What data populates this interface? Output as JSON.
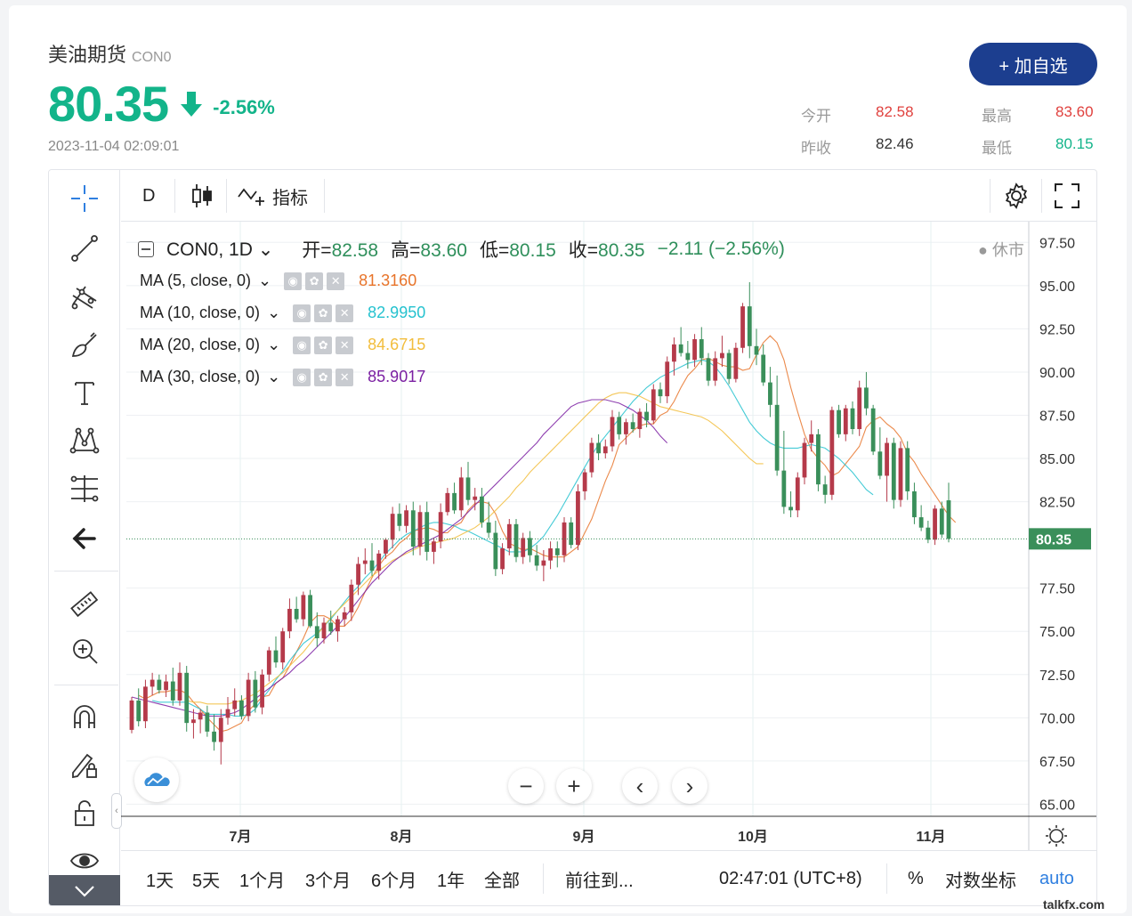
{
  "header": {
    "name": "美油期货",
    "code": "CON0",
    "price": "80.35",
    "change_pct": "-2.56%",
    "timestamp": "2023-11-04 02:09:01",
    "add_button": "+ 加自选"
  },
  "stats": {
    "open_label": "今开",
    "open_value": "82.58",
    "high_label": "最高",
    "high_value": "83.60",
    "prev_label": "昨收",
    "prev_value": "82.46",
    "low_label": "最低",
    "low_value": "80.15"
  },
  "toolbar": {
    "interval": "D",
    "indicators": "指标"
  },
  "legend": {
    "symbol": "CON0, 1D",
    "open_label": "开=",
    "open": "82.58",
    "high_label": "高=",
    "high": "83.60",
    "low_label": "低=",
    "low": "80.15",
    "close_label": "收=",
    "close": "80.35",
    "change": "−2.11 (−2.56%)",
    "market_status": "休市"
  },
  "ma_lines": [
    {
      "label": "MA (5, close, 0)",
      "value": "81.3160",
      "color": "#e8742a"
    },
    {
      "label": "MA (10, close, 0)",
      "value": "82.9950",
      "color": "#25c2cf"
    },
    {
      "label": "MA (20, close, 0)",
      "value": "84.6715",
      "color": "#f2bd3c"
    },
    {
      "label": "MA (30, close, 0)",
      "value": "85.9017",
      "color": "#7b1fa2"
    }
  ],
  "bottom_bar": {
    "ranges": [
      "1天",
      "5天",
      "1个月",
      "3个月",
      "6个月",
      "1年",
      "全部"
    ],
    "goto": "前往到...",
    "clock": "02:47:01 (UTC+8)",
    "percent": "%",
    "log": "对数坐标",
    "auto": "auto"
  },
  "watermark": "talkfx.com",
  "colors": {
    "up": "#b53a4a",
    "down": "#3a8f5a",
    "price_tag": "#3a8f5a"
  },
  "chart_data": {
    "type": "candlestick",
    "x_tick_labels": [
      "7月",
      "8月",
      "9月",
      "10月",
      "11月"
    ],
    "y_tick_labels": [
      "97.50",
      "95.00",
      "92.50",
      "90.00",
      "87.50",
      "85.00",
      "82.50",
      "80.35",
      "77.50",
      "75.00",
      "72.50",
      "70.00",
      "67.50",
      "65.00"
    ],
    "y_ticks": [
      97.5,
      95,
      92.5,
      90,
      87.5,
      85,
      82.5,
      77.5,
      75,
      72.5,
      70,
      67.5,
      65
    ],
    "ylim": [
      64.3,
      98.7
    ],
    "last_price": 80.35,
    "last_price_label": "80.35",
    "grid": true,
    "ohlc": [
      [
        69.3,
        71.2,
        69.1,
        71.0
      ],
      [
        71.0,
        71.7,
        69.5,
        69.8
      ],
      [
        69.8,
        72.2,
        69.4,
        71.8
      ],
      [
        71.8,
        72.6,
        71.3,
        72.2
      ],
      [
        72.2,
        72.5,
        71.4,
        71.6
      ],
      [
        71.6,
        72.5,
        71.2,
        72.1
      ],
      [
        72.1,
        72.9,
        70.7,
        71.0
      ],
      [
        71.0,
        73.2,
        70.7,
        72.6
      ],
      [
        72.6,
        73.0,
        69.2,
        69.7
      ],
      [
        69.7,
        70.5,
        68.8,
        69.9
      ],
      [
        69.9,
        70.5,
        69.1,
        70.3
      ],
      [
        70.3,
        70.7,
        68.9,
        69.2
      ],
      [
        69.2,
        70.2,
        68.1,
        68.6
      ],
      [
        68.6,
        70.5,
        67.3,
        70.0
      ],
      [
        70.0,
        71.2,
        69.6,
        70.5
      ],
      [
        70.5,
        71.7,
        70.1,
        71.0
      ],
      [
        71.0,
        71.3,
        69.9,
        70.1
      ],
      [
        70.1,
        72.6,
        69.8,
        72.2
      ],
      [
        72.2,
        72.7,
        70.3,
        70.6
      ],
      [
        70.6,
        72.8,
        70.2,
        72.5
      ],
      [
        72.5,
        74.1,
        72.1,
        73.9
      ],
      [
        73.9,
        74.7,
        72.9,
        73.2
      ],
      [
        73.2,
        75.2,
        72.8,
        75.0
      ],
      [
        75.0,
        76.9,
        74.6,
        76.3
      ],
      [
        76.3,
        77.0,
        75.5,
        75.7
      ],
      [
        75.7,
        77.3,
        75.3,
        77.1
      ],
      [
        77.1,
        77.4,
        75.2,
        75.3
      ],
      [
        75.3,
        76.1,
        74.1,
        74.6
      ],
      [
        74.6,
        75.8,
        74.3,
        75.5
      ],
      [
        75.5,
        76.2,
        74.8,
        75.0
      ],
      [
        75.0,
        75.9,
        74.4,
        75.7
      ],
      [
        75.7,
        76.4,
        75.3,
        76.1
      ],
      [
        76.1,
        78.0,
        75.6,
        77.7
      ],
      [
        77.7,
        79.3,
        77.1,
        78.9
      ],
      [
        78.9,
        79.8,
        78.3,
        79.1
      ],
      [
        79.1,
        80.1,
        78.2,
        78.5
      ],
      [
        78.5,
        79.7,
        78.0,
        79.5
      ],
      [
        79.5,
        80.4,
        79.2,
        80.3
      ],
      [
        80.3,
        82.2,
        79.8,
        81.8
      ],
      [
        81.8,
        82.4,
        80.8,
        81.1
      ],
      [
        81.1,
        82.3,
        80.7,
        82.0
      ],
      [
        82.0,
        82.5,
        79.4,
        79.9
      ],
      [
        79.9,
        82.3,
        79.4,
        81.9
      ],
      [
        81.9,
        82.5,
        79.1,
        79.6
      ],
      [
        79.6,
        80.4,
        78.9,
        80.2
      ],
      [
        80.2,
        82.4,
        79.8,
        81.9
      ],
      [
        81.9,
        83.3,
        81.7,
        83.0
      ],
      [
        83.0,
        83.6,
        81.8,
        82.0
      ],
      [
        82.0,
        84.5,
        81.6,
        83.9
      ],
      [
        83.9,
        84.8,
        82.3,
        82.6
      ],
      [
        82.6,
        83.3,
        82.0,
        82.8
      ],
      [
        82.8,
        83.3,
        81.0,
        81.3
      ],
      [
        81.3,
        82.5,
        80.4,
        80.7
      ],
      [
        80.7,
        81.4,
        78.2,
        78.6
      ],
      [
        78.6,
        80.1,
        78.3,
        79.8
      ],
      [
        79.8,
        81.5,
        79.4,
        81.2
      ],
      [
        81.2,
        81.5,
        79.0,
        79.3
      ],
      [
        79.3,
        80.7,
        78.9,
        80.4
      ],
      [
        80.4,
        80.8,
        79.0,
        79.4
      ],
      [
        79.4,
        80.0,
        78.5,
        78.8
      ],
      [
        78.8,
        79.7,
        77.9,
        79.1
      ],
      [
        79.1,
        80.2,
        78.6,
        79.8
      ],
      [
        79.8,
        80.2,
        78.7,
        79.4
      ],
      [
        79.4,
        81.6,
        79.0,
        81.3
      ],
      [
        81.3,
        81.6,
        79.8,
        80.0
      ],
      [
        80.0,
        83.5,
        79.7,
        83.1
      ],
      [
        83.1,
        84.4,
        82.6,
        84.2
      ],
      [
        84.2,
        86.2,
        83.9,
        85.9
      ],
      [
        85.9,
        86.4,
        84.9,
        85.3
      ],
      [
        85.3,
        86.1,
        85.0,
        85.7
      ],
      [
        85.7,
        87.8,
        85.4,
        87.4
      ],
      [
        87.4,
        87.7,
        86.1,
        86.4
      ],
      [
        86.4,
        87.3,
        85.8,
        87.1
      ],
      [
        87.1,
        87.6,
        86.5,
        86.7
      ],
      [
        86.7,
        87.9,
        86.2,
        87.7
      ],
      [
        87.7,
        88.2,
        86.8,
        87.2
      ],
      [
        87.2,
        89.3,
        87.0,
        89.0
      ],
      [
        89.0,
        89.4,
        88.2,
        88.6
      ],
      [
        88.6,
        90.9,
        88.2,
        90.6
      ],
      [
        90.6,
        92.0,
        89.8,
        91.6
      ],
      [
        91.6,
        92.6,
        90.9,
        91.1
      ],
      [
        91.1,
        91.8,
        90.2,
        90.7
      ],
      [
        90.7,
        92.2,
        90.3,
        91.9
      ],
      [
        91.9,
        92.6,
        90.4,
        90.8
      ],
      [
        90.8,
        91.1,
        89.2,
        89.5
      ],
      [
        89.5,
        91.2,
        89.2,
        90.8
      ],
      [
        90.8,
        92.1,
        90.3,
        91.1
      ],
      [
        91.1,
        91.3,
        89.3,
        89.6
      ],
      [
        89.6,
        91.7,
        89.4,
        91.4
      ],
      [
        91.4,
        94.0,
        91.1,
        93.8
      ],
      [
        93.8,
        95.2,
        90.8,
        91.5
      ],
      [
        91.5,
        92.5,
        90.4,
        91.0
      ],
      [
        91.0,
        91.6,
        89.2,
        89.4
      ],
      [
        89.4,
        90.3,
        87.4,
        88.1
      ],
      [
        88.1,
        89.8,
        84.0,
        84.3
      ],
      [
        84.3,
        86.6,
        81.8,
        82.2
      ],
      [
        82.2,
        83.1,
        81.6,
        82.0
      ],
      [
        82.0,
        84.2,
        81.6,
        83.9
      ],
      [
        83.9,
        86.2,
        83.5,
        85.9
      ],
      [
        85.9,
        87.2,
        85.4,
        86.4
      ],
      [
        86.4,
        86.7,
        83.1,
        83.5
      ],
      [
        83.5,
        84.0,
        82.4,
        82.9
      ],
      [
        82.9,
        88.0,
        82.6,
        87.8
      ],
      [
        87.8,
        88.1,
        86.2,
        86.4
      ],
      [
        86.4,
        88.1,
        86.0,
        87.9
      ],
      [
        87.9,
        88.3,
        86.4,
        86.7
      ],
      [
        86.7,
        89.5,
        86.3,
        89.1
      ],
      [
        89.1,
        90.0,
        87.5,
        87.9
      ],
      [
        87.9,
        88.1,
        85.2,
        85.4
      ],
      [
        85.4,
        86.8,
        83.8,
        84.0
      ],
      [
        84.0,
        86.2,
        82.5,
        85.9
      ],
      [
        85.9,
        86.2,
        82.1,
        82.6
      ],
      [
        82.6,
        86.0,
        82.2,
        85.6
      ],
      [
        85.6,
        86.0,
        82.6,
        83.1
      ],
      [
        83.1,
        83.6,
        81.2,
        81.6
      ],
      [
        81.6,
        82.3,
        80.8,
        81.0
      ],
      [
        81.0,
        81.4,
        80.1,
        80.3
      ],
      [
        80.3,
        82.3,
        80.0,
        82.1
      ],
      [
        82.1,
        82.5,
        80.4,
        80.6
      ],
      [
        82.58,
        83.6,
        80.15,
        80.35
      ]
    ],
    "ma_series": [
      {
        "name": "MA (5, close, 0)",
        "color": "#e8742a",
        "start_index": 1,
        "values": [
          71.3,
          71.1,
          71.3,
          71.5,
          71.5,
          71.6,
          71.6,
          71.4,
          70.9,
          70.5,
          70.0,
          69.6,
          69.2,
          69.3,
          69.5,
          69.7,
          70.4,
          70.8,
          71.2,
          71.3,
          72.0,
          72.3,
          73.0,
          73.8,
          74.6,
          75.5,
          75.9,
          75.9,
          75.7,
          75.3,
          75.3,
          75.7,
          76.4,
          77.3,
          78.1,
          78.8,
          79.3,
          79.6,
          80.1,
          80.4,
          80.8,
          80.9,
          81.0,
          80.9,
          80.7,
          80.7,
          81.1,
          81.3,
          82.0,
          82.4,
          82.5,
          82.4,
          81.8,
          80.8,
          80.1,
          79.9,
          79.7,
          79.8,
          79.6,
          79.4,
          79.3,
          79.3,
          79.3,
          79.6,
          79.9,
          80.7,
          81.5,
          82.6,
          83.7,
          84.6,
          85.8,
          86.2,
          86.6,
          86.9,
          87.0,
          87.0,
          87.5,
          87.7,
          88.3,
          89.1,
          89.8,
          90.2,
          90.7,
          90.8,
          90.6,
          90.4,
          90.3,
          90.3,
          90.1,
          90.2,
          91.0,
          91.7,
          92.1,
          91.7,
          90.7,
          89.1,
          87.7,
          86.4,
          85.5,
          85.0,
          84.6,
          84.0,
          84.2,
          84.7,
          85.2,
          85.7,
          86.8,
          87.2,
          87.4,
          87.0,
          86.7,
          86.2,
          85.3,
          84.8,
          84.1,
          83.5,
          82.9,
          82.3,
          81.7,
          81.3
        ]
      },
      {
        "name": "MA (10, close, 0)",
        "color": "#25c2cf",
        "start_index": 3,
        "values": [
          71.0,
          70.9,
          70.9,
          70.9,
          70.9,
          70.9,
          70.7,
          70.5,
          70.2,
          70.2,
          70.2,
          70.2,
          70.1,
          70.1,
          70.2,
          70.5,
          71.1,
          71.6,
          72.2,
          72.7,
          73.3,
          73.8,
          74.3,
          74.6,
          74.9,
          75.3,
          75.7,
          76.2,
          76.7,
          77.2,
          77.6,
          78.1,
          78.5,
          79.0,
          79.5,
          79.9,
          80.3,
          80.6,
          80.8,
          81.0,
          81.2,
          81.3,
          81.3,
          81.2,
          81.1,
          80.9,
          80.8,
          80.6,
          80.4,
          80.2,
          80.0,
          79.8,
          79.6,
          79.6,
          79.6,
          79.8,
          80.1,
          80.5,
          81.1,
          81.7,
          82.4,
          83.1,
          83.8,
          84.5,
          85.2,
          85.8,
          86.3,
          86.8,
          87.3,
          87.8,
          88.3,
          88.7,
          89.1,
          89.4,
          89.7,
          89.9,
          90.1,
          90.3,
          90.5,
          90.6,
          90.7,
          90.6,
          90.3,
          89.8,
          89.2,
          88.5,
          87.8,
          87.1,
          86.6,
          86.2,
          85.9,
          85.7,
          85.6,
          85.6,
          85.6,
          85.7,
          85.8,
          85.7,
          85.6,
          85.3,
          85.0,
          84.6,
          84.2,
          83.7,
          83.2,
          82.9
        ]
      },
      {
        "name": "MA (20, close, 0)",
        "color": "#f2bd3c",
        "start_index": 8,
        "values": [
          71.0,
          70.9,
          70.9,
          70.8,
          70.8,
          70.8,
          70.8,
          70.9,
          71.0,
          71.2,
          71.4,
          71.7,
          72.0,
          72.3,
          72.6,
          73.0,
          73.4,
          73.8,
          74.3,
          74.8,
          75.3,
          75.8,
          76.2,
          76.6,
          77.0,
          77.4,
          77.8,
          78.2,
          78.5,
          78.8,
          79.1,
          79.3,
          79.5,
          79.7,
          79.9,
          80.0,
          80.1,
          80.2,
          80.3,
          80.4,
          80.6,
          80.8,
          81.0,
          81.3,
          81.6,
          82.0,
          82.4,
          82.8,
          83.3,
          83.7,
          84.2,
          84.6,
          85.0,
          85.4,
          85.8,
          86.2,
          86.6,
          87.0,
          87.4,
          87.8,
          88.2,
          88.5,
          88.7,
          88.8,
          88.8,
          88.7,
          88.6,
          88.4,
          88.2,
          88.0,
          87.9,
          87.8,
          87.7,
          87.6,
          87.5,
          87.4,
          87.2,
          86.9,
          86.6,
          86.2,
          85.8,
          85.4,
          85.0,
          84.7,
          84.7
        ]
      },
      {
        "name": "MA (30, close, 0)",
        "color": "#7b1fa2",
        "start_index": 0,
        "values": [
          71.2,
          71.1,
          71.0,
          70.9,
          70.8,
          70.7,
          70.6,
          70.5,
          70.4,
          70.3,
          70.2,
          70.1,
          70.1,
          70.1,
          70.2,
          70.3,
          70.5,
          70.8,
          71.1,
          71.4,
          71.7,
          72.0,
          72.3,
          72.6,
          73.0,
          73.3,
          73.7,
          74.1,
          74.5,
          74.9,
          75.3,
          75.8,
          76.3,
          76.8,
          77.3,
          77.8,
          78.2,
          78.6,
          79.0,
          79.3,
          79.6,
          79.8,
          80.0,
          80.2,
          80.4,
          80.6,
          80.9,
          81.2,
          81.5,
          81.9,
          82.3,
          82.7,
          83.1,
          83.5,
          83.9,
          84.3,
          84.7,
          85.1,
          85.5,
          85.9,
          86.4,
          86.8,
          87.2,
          87.6,
          88.0,
          88.2,
          88.3,
          88.4,
          88.4,
          88.4,
          88.3,
          88.2,
          88.0,
          87.8,
          87.5,
          87.2,
          86.8,
          86.3,
          85.9
        ]
      }
    ]
  }
}
